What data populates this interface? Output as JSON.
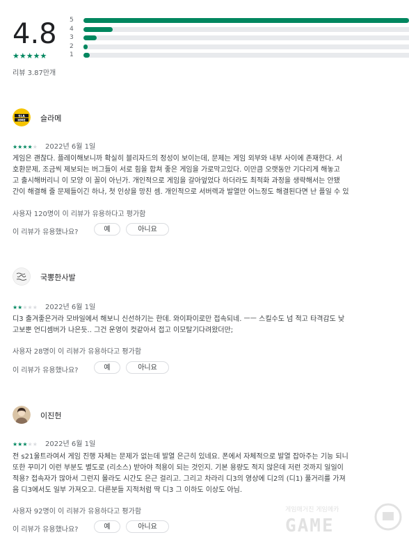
{
  "summary": {
    "rating": "4.8",
    "stars": "★★★★★",
    "review_count": "리뷰 3.87만개",
    "distribution": [
      {
        "label": "5",
        "fraction": 1.0
      },
      {
        "label": "4",
        "fraction": 0.09
      },
      {
        "label": "3",
        "fraction": 0.04
      },
      {
        "label": "2",
        "fraction": 0.005
      },
      {
        "label": "1",
        "fraction": 0.02
      }
    ]
  },
  "reviews": [
    {
      "author": "슬라메",
      "avatar_icon": "slame-logo",
      "stars_on": "★★★★",
      "stars_off": "★",
      "rating": 4,
      "date": "2022년 6월 1일",
      "lines": [
        "게임은 괜찮다. 플레이해보니까 확실히 블리자드의 정성이 보이는데, 문제는 게임 외부와 내부 사이에 존재한다. 서",
        "호환문제, 조금씩 제보되는 버그들이 서로 힘을 합쳐 좋은 게임을 가로막고있다. 이만큼 오랫동안 기다리게 해놓고",
        "고 출시해버리니 이 모양 이 꼴이 아닌가. 개인적으로 게임을 갈아엎었다 하더라도 최적화 과정을 생략해서는 안됐",
        "간이 해결해 줄 문제들이긴 하나, 첫 인상을 망친 셈. 개인적으로 서버렉과 발열만 어느정도 해결된다면 난 플일 수 있"
      ],
      "helpful_count": "사용자 120명이 이 리뷰가 유용하다고 평가함",
      "helpful_question": "이 리뷰가 유용했나요?",
      "yes_label": "예",
      "no_label": "아니요"
    },
    {
      "author": "국뽕한사발",
      "avatar_icon": "calligraphy-avatar",
      "stars_on": "★★",
      "stars_off": "★★★",
      "rating": 2,
      "date": "2022년 6월 1일",
      "lines": [
        "디3 출겨좋은거라 모바일에서 해보니 신선하기는 한데. 와이파이로만 접속되네. ㅡㅡ 스킬수도 넘 적고 타격감도 낮",
        "고보뿐 언디셈버가 나은듯.. 그건 운영이 컷같아서 접고 이모탈기다려왔더만;"
      ],
      "helpful_count": "사용자 28명이 이 리뷰가 유용하다고 평가함",
      "helpful_question": "이 리뷰가 유용했나요?",
      "yes_label": "예",
      "no_label": "아니요"
    },
    {
      "author": "이진헌",
      "avatar_icon": "profile-photo",
      "stars_on": "★★★",
      "stars_off": "★★",
      "rating": 3,
      "date": "2022년 6월 1일",
      "lines": [
        "전 s21울트라여서 게임 진행 자체는 문제가 없는데 발열 은근히 있네요. 폰에서 자체적으로 발열 잡아주는 기능 되니",
        "또한 꾸미기 이런 부분도 별도로 (리소스) 받아야 적용이 되는 것인지. 기본 용량도 적지 않은데 저런 것까지 일일이",
        "적용? 접속자가 많아서 그런지 몰라도 시간도 은근 걸리고. 그리고 차라리 디3의 영상에 디2의 (디1) 풀거리를 가져",
        "음 디3에서도 일부 가져오고. 다른분들 지적처럼 딱 디3 그 이하도 이상도 아님."
      ],
      "helpful_count": "사용자 92명이 이 리뷰가 유용하다고 평가함",
      "helpful_question": "이 리뷰가 유용했나요?",
      "yes_label": "예",
      "no_label": "아니요"
    }
  ],
  "watermark": {
    "text": "게임매거진 게임메카",
    "logo": "GAME"
  },
  "colors": {
    "accent": "#01875f",
    "track": "#e8eaed"
  }
}
